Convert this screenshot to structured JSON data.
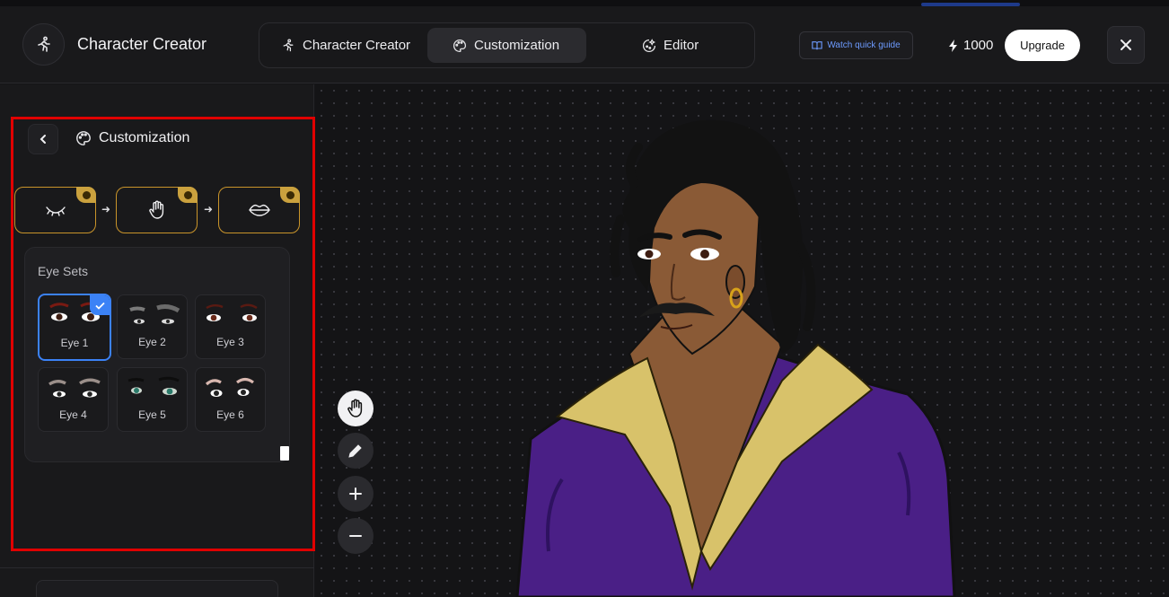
{
  "header": {
    "app_title": "Character Creator",
    "tabs": [
      {
        "label": "Character Creator",
        "icon": "running-person-icon",
        "active": false
      },
      {
        "label": "Customization",
        "icon": "palette-icon",
        "active": true
      },
      {
        "label": "Editor",
        "icon": "magic-edit-icon",
        "active": false
      }
    ],
    "guide_label": "Watch quick guide",
    "credits": "1000",
    "upgrade_label": "Upgrade"
  },
  "panel": {
    "title": "Customization",
    "steps": [
      {
        "icon": "closed-eye-icon"
      },
      {
        "icon": "hand-icon"
      },
      {
        "icon": "lips-icon"
      }
    ],
    "eye_sets_title": "Eye Sets",
    "eye_sets": [
      {
        "label": "Eye 1",
        "selected": true
      },
      {
        "label": "Eye 2",
        "selected": false
      },
      {
        "label": "Eye 3",
        "selected": false
      },
      {
        "label": "Eye 4",
        "selected": false
      },
      {
        "label": "Eye 5",
        "selected": false
      },
      {
        "label": "Eye 6",
        "selected": false
      }
    ]
  },
  "canvas_tools": [
    {
      "icon": "hand-pan-icon",
      "active": true
    },
    {
      "icon": "pencil-icon",
      "active": false
    },
    {
      "icon": "zoom-in-icon",
      "active": false
    },
    {
      "icon": "zoom-out-icon",
      "active": false
    }
  ],
  "colors": {
    "accent_blue": "#3b82f6",
    "step_border": "#c9942a",
    "highlight": "#e00000",
    "shirt": "#4a1f86",
    "collar": "#d8c26a",
    "skin": "#8a5a36"
  }
}
